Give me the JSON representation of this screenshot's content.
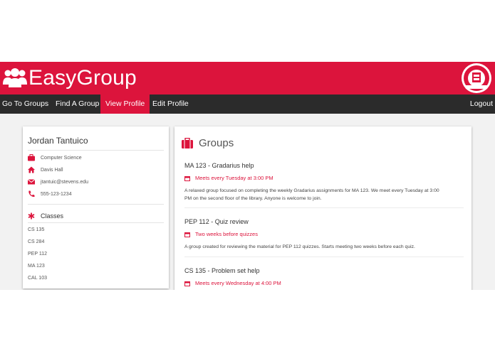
{
  "header": {
    "brand_name": "EasyGroup",
    "brand_icon": "users-icon",
    "seal_icon": "university-seal-icon",
    "color": "#dc143c"
  },
  "nav": {
    "items": [
      {
        "label": "Go To Groups"
      },
      {
        "label": "Find A Group"
      },
      {
        "label": "View Profile",
        "active": true
      },
      {
        "label": "Edit Profile"
      }
    ],
    "logout_label": "Logout",
    "background": "#2b2b2b"
  },
  "profile": {
    "name": "Jordan Tantuico",
    "major": "Computer Science",
    "residence": "Davis Hall",
    "email": "jtantuic@stevens.edu",
    "phone": "555-123-1234",
    "classes_title": "Classes",
    "classes": [
      "CS 135",
      "CS 284",
      "PEP 112",
      "MA 123",
      "CAL 103"
    ]
  },
  "groups": {
    "title": "Groups",
    "items": [
      {
        "name": "MA 123 - Gradarius help",
        "schedule": "Meets every Tuesday at 3:00 PM",
        "description_line1": "A relaxed group focused on completing the weekly Gradarius assignments for MA 123. We meet every Tuesday at 3:00",
        "description_line2": "PM on the second floor of the library. Anyone is welcome to join."
      },
      {
        "name": "PEP 112 - Quiz review",
        "schedule": "Two weeks before quizzes",
        "description_line1": "A group created for reviewing the material for PEP 112 quizzes. Starts meeting two weeks before each quiz.",
        "description_line2": ""
      },
      {
        "name": "CS 135 - Problem set help",
        "schedule": "Meets every Wednesday at 4:00 PM",
        "description_line1": "",
        "description_line2": ""
      }
    ]
  }
}
